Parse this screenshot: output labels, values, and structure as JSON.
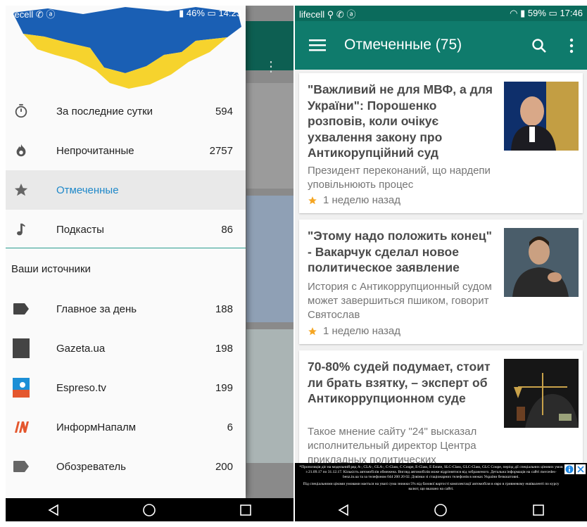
{
  "left": {
    "status_bar": {
      "carrier": "ifecell",
      "battery": "46%",
      "time": "14:23"
    },
    "nav_items": [
      {
        "label": "За последние сутки",
        "count": "594",
        "icon": "timer-icon"
      },
      {
        "label": "Непрочитанные",
        "count": "2757",
        "icon": "flame-icon"
      },
      {
        "label": "Отмеченные",
        "count": "",
        "icon": "star-icon",
        "active": true
      },
      {
        "label": "Подкасты",
        "count": "86",
        "icon": "music-note-icon"
      }
    ],
    "sources_title": "Ваши источники",
    "sources": [
      {
        "label": "Главное за день",
        "count": "188",
        "icon": "tag-icon"
      },
      {
        "label": "Gazeta.ua",
        "count": "198",
        "icon": "gazeta-logo"
      },
      {
        "label": "Espreso.tv",
        "count": "199",
        "icon": "espreso-logo"
      },
      {
        "label": "ИнформНапалм",
        "count": "6",
        "icon": "informnapalm-logo"
      },
      {
        "label": "Обозреватель",
        "count": "200",
        "icon": "tag-icon"
      }
    ],
    "colors": {
      "accent": "#1e88c9",
      "teal": "#0f7b6c",
      "flag_blue": "#1a5fb4",
      "flag_yellow": "#f6d32d"
    }
  },
  "right": {
    "status_bar": {
      "carrier": "lifecell",
      "battery": "59%",
      "time": "17:46"
    },
    "toolbar": {
      "title": "Отмеченные (75)"
    },
    "articles": [
      {
        "title": "\"Важливий не для МВФ, а для України\": Порошенко розповів, коли очікує ухвалення закону про Антикорупційний суд",
        "summary": "Президент переконаний, що нардепи уповільнюють процес",
        "time": "1 неделю назад"
      },
      {
        "title": "\"Этому надо положить конец\" - Вакарчук сделал новое политическое заявление",
        "summary": "История с Антикоррупционный судом может завершиться пшиком, говорит Святослав",
        "time": "1 неделю назад"
      },
      {
        "title": "70-80% судей подумает, стоит ли брать взятку, – эксперт об Антикоррупционном суде",
        "summary": "Такое мнение сайту \"24\" высказал исполнительный директор Центра прикладных политических",
        "time": ""
      }
    ],
    "ad": {
      "line1": "*Пропозиція діє на модельний ряд A-, CLA-, GLA-, C-Class, C Coupe, E-Class, E Estate, SLC-Class, GLC-Class, GLC Coupe, період дії спеціальних цінових умов з 21.09.17 по 31.12.17. Кількість автомобілів обмежена. Вигляд автомобілів може відрізнятися від зображеного. Детальна інформація на сайті mercedes-benz.in.ua та за телефоном 044 200 20 02. Дзвінки зі стаціонарних телефонів в межах України безкоштовні.",
      "line2": "Під спеціальними цінами умовами мається на увазі сума знижки 5% від базової вартості комплектації автомобіля в євро в гривневому еквіваленті по курсу валют, що вказано на сайті."
    }
  }
}
